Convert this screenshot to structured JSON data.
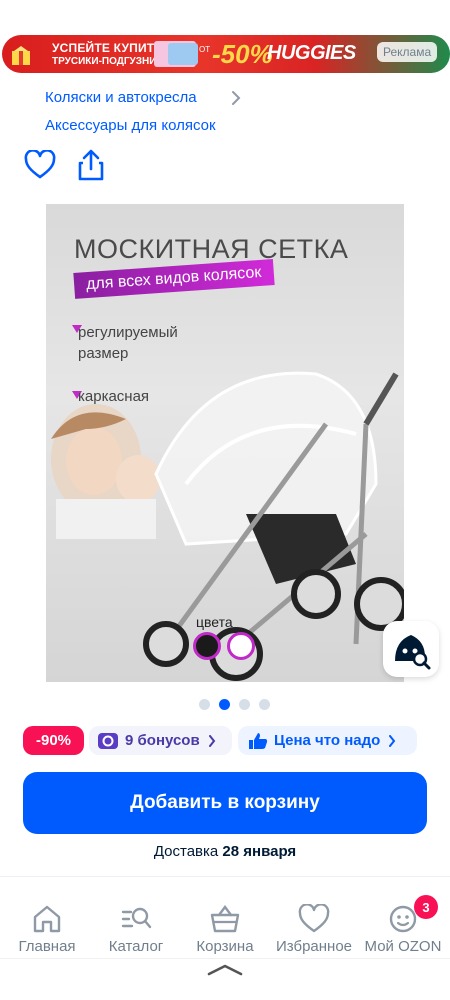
{
  "ad_banner": {
    "line1": "УСПЕЙТЕ КУПИТЬ!",
    "line2": "ТРУСИКИ-ПОДГУЗНИКИ",
    "from_label": "ОТ",
    "discount": "-50%",
    "brand": "HUGGIES",
    "ad_label": "Реклама"
  },
  "breadcrumbs": {
    "items": [
      "Коляски и автокресла",
      "Аксессуары для колясок"
    ]
  },
  "product_image": {
    "title": "МОСКИТНАЯ СЕТКА",
    "subtitle": "для всех видов колясок",
    "bullet1_line1": "регулируемый",
    "bullet1_line2": "размер",
    "bullet2": "каркасная",
    "colors_label": "цвета",
    "swatches": [
      "#1a1a1a",
      "#ffffff"
    ],
    "carousel_index": 2,
    "carousel_total": 4
  },
  "chips": {
    "discount": "-90%",
    "bonus": "9 бонусов",
    "price": "Цена что надо"
  },
  "cart_button": "Добавить в корзину",
  "delivery": {
    "prefix": "Доставка",
    "date": "28 января"
  },
  "nav": {
    "items": [
      "Главная",
      "Каталог",
      "Корзина",
      "Избранное",
      "Мой OZON"
    ],
    "badge": "3"
  },
  "colors": {
    "accent": "#005bff",
    "discount": "#f91155"
  }
}
